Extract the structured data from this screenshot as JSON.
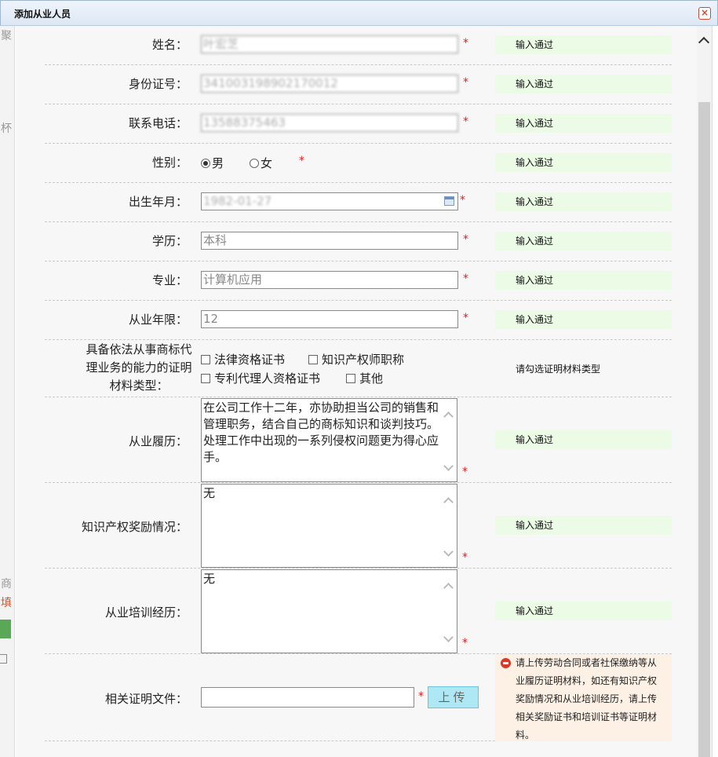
{
  "dialog": {
    "title": "添加从业人员",
    "close_icon": "close-icon"
  },
  "background_page": {
    "chars": [
      "聚",
      "杯",
      "商",
      "填"
    ]
  },
  "ok_text": "输入通过",
  "required_mark": "*",
  "fields": {
    "name": {
      "label": "姓名：",
      "value": "叶宏芝"
    },
    "id_number": {
      "label": "身份证号：",
      "value": "341003198902170012"
    },
    "phone": {
      "label": "联系电话：",
      "value": "13588375463"
    },
    "gender": {
      "label": "性别：",
      "male": "男",
      "female": "女",
      "selected": "男"
    },
    "birth": {
      "label": "出生年月：",
      "value": "1982-01-27",
      "icon": "calendar-icon"
    },
    "education": {
      "label": "学历：",
      "value": "本科"
    },
    "major": {
      "label": "专业：",
      "value": "计算机应用"
    },
    "years": {
      "label": "从业年限：",
      "value": "12"
    },
    "proof_type": {
      "label": "具备依法从事商标代理业务的能力的证明材料类型：",
      "options": [
        "法律资格证书",
        "知识产权师职称",
        "专利代理人资格证书",
        "其他"
      ],
      "message": "请勾选证明材料类型"
    },
    "work_history": {
      "label": "从业履历：",
      "value": "在公司工作十二年，亦协助担当公司的销售和管理职务，结合自己的商标知识和谈判技巧。处理工作中出现的一系列侵权问题更为得心应手。"
    },
    "ip_awards": {
      "label": "知识产权奖励情况：",
      "value": "无"
    },
    "training": {
      "label": "从业培训经历：",
      "value": "无"
    },
    "documents": {
      "label": "相关证明文件：",
      "value": "",
      "upload_label": "上传",
      "warning": "请上传劳动合同或者社保缴纳等从业履历证明材料，如还有知识产权奖励情况和从业培训经历，请上传相关奖励证书和培训证书等证明材料。"
    }
  },
  "colors": {
    "ok_bg": "#ebfbe6",
    "warn_bg": "#fdf0e4",
    "required": "#e02020",
    "upload_bg": "#aee8f5"
  }
}
